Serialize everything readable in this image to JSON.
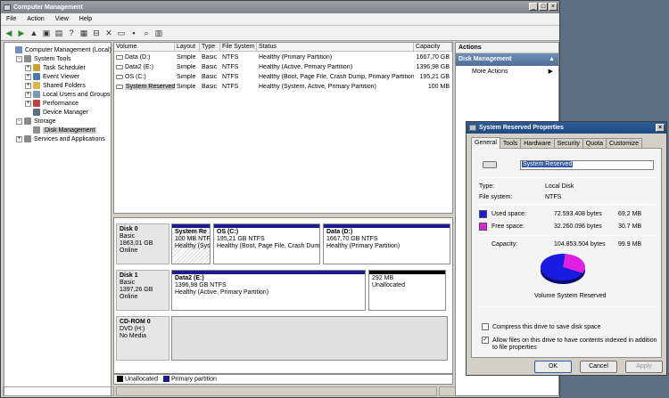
{
  "window": {
    "title": "Computer Management"
  },
  "menu": [
    "File",
    "Action",
    "View",
    "Help"
  ],
  "tree": [
    {
      "label": "Computer Management (Local)",
      "level": 0,
      "exp": "",
      "icon": "computer-icon",
      "color": "#6f8fb8"
    },
    {
      "label": "System Tools",
      "level": 1,
      "exp": "−",
      "icon": "tools-icon",
      "color": "#8a8a8a"
    },
    {
      "label": "Task Scheduler",
      "level": 2,
      "exp": "+",
      "icon": "clock-icon",
      "color": "#c9a23a"
    },
    {
      "label": "Event Viewer",
      "level": 2,
      "exp": "+",
      "icon": "event-icon",
      "color": "#4a78b0"
    },
    {
      "label": "Shared Folders",
      "level": 2,
      "exp": "+",
      "icon": "folder-icon",
      "color": "#e0b64a"
    },
    {
      "label": "Local Users and Groups",
      "level": 2,
      "exp": "+",
      "icon": "users-icon",
      "color": "#7a9ab8"
    },
    {
      "label": "Performance",
      "level": 2,
      "exp": "+",
      "icon": "performance-icon",
      "color": "#c04040"
    },
    {
      "label": "Device Manager",
      "level": 2,
      "exp": "",
      "icon": "device-icon",
      "color": "#607080"
    },
    {
      "label": "Storage",
      "level": 1,
      "exp": "−",
      "icon": "storage-icon",
      "color": "#8a8a8a"
    },
    {
      "label": "Disk Management",
      "level": 2,
      "exp": "",
      "icon": "disk-icon",
      "color": "#909090",
      "selected": true
    },
    {
      "label": "Services and Applications",
      "level": 1,
      "exp": "+",
      "icon": "services-icon",
      "color": "#8a8a8a"
    }
  ],
  "volumes": {
    "columns": [
      "Volume",
      "Layout",
      "Type",
      "File System",
      "Status",
      "Capacity"
    ],
    "rows": [
      [
        "Data (D:)",
        "Simple",
        "Basic",
        "NTFS",
        "Healthy (Primary Partition)",
        "1667,70 GB"
      ],
      [
        "Data2 (E:)",
        "Simple",
        "Basic",
        "NTFS",
        "Healthy (Active, Primary Partition)",
        "1396,98 GB"
      ],
      [
        "OS (C:)",
        "Simple",
        "Basic",
        "NTFS",
        "Healthy (Boot, Page File, Crash Dump, Primary Partition)",
        "195,21 GB"
      ],
      [
        "System Reserved",
        "Simple",
        "Basic",
        "NTFS",
        "Healthy (System, Active, Primary Partition)",
        "100 MB"
      ]
    ]
  },
  "disks": [
    {
      "name": "Disk 0",
      "type": "Basic",
      "size": "1863,01 GB",
      "state": "Online",
      "parts": [
        {
          "title": "System Re",
          "line2": "100 MB NTFS",
          "line3": "Healthy (Sys",
          "w": 44,
          "hatched": true
        },
        {
          "title": "OS  (C:)",
          "line2": "195,21 GB NTFS",
          "line3": "Healthy (Boot, Page File, Crash Dump",
          "w": 120
        },
        {
          "title": "Data  (D:)",
          "line2": "1667,70 GB NTFS",
          "line3": "Healthy (Primary Partition)",
          "w": 143
        }
      ]
    },
    {
      "name": "Disk 1",
      "type": "Basic",
      "size": "1397,26 GB",
      "state": "Online",
      "parts": [
        {
          "title": "Data2  (E:)",
          "line2": "1396,98 GB NTFS",
          "line3": "Healthy (Active, Primary Partition)",
          "w": 218
        },
        {
          "title": "",
          "line2": "292 MB",
          "line3": "Unallocated",
          "w": 87,
          "unalloc": true
        }
      ]
    },
    {
      "name": "CD-ROM 0",
      "type": "DVD (H:)",
      "size": "",
      "state": "No Media",
      "parts": []
    }
  ],
  "legend": [
    {
      "label": "Unallocated",
      "color": "#000000"
    },
    {
      "label": "Primary partition",
      "color": "#1c1c8c"
    }
  ],
  "actions": {
    "header": "Actions",
    "section": "Disk Management",
    "more": "More Actions"
  },
  "dialog": {
    "title": "System Reserved Properties",
    "tabs": [
      "General",
      "Tools",
      "Hardware",
      "Security",
      "Quota",
      "Customize"
    ],
    "name_value": "System Reserved",
    "type_label": "Type:",
    "type_value": "Local Disk",
    "fs_label": "File system:",
    "fs_value": "NTFS",
    "used_label": "Used space:",
    "used_bytes": "72.593.408 bytes",
    "used_mb": "69.2 MB",
    "used_color": "#1a1ae0",
    "free_label": "Free space:",
    "free_bytes": "32.260.096 bytes",
    "free_mb": "30.7 MB",
    "free_color": "#e020e0",
    "cap_label": "Capacity:",
    "cap_bytes": "104.853.504 bytes",
    "cap_mb": "99.9 MB",
    "pie_used_fraction": 0.692,
    "volume_label": "Volume System Reserved",
    "compress_label": "Compress this drive to save disk space",
    "compress_checked": false,
    "index_label": "Allow files on this drive to have contents indexed in addition to file properties",
    "index_checked": true,
    "ok": "OK",
    "cancel": "Cancel",
    "apply": "Apply"
  }
}
